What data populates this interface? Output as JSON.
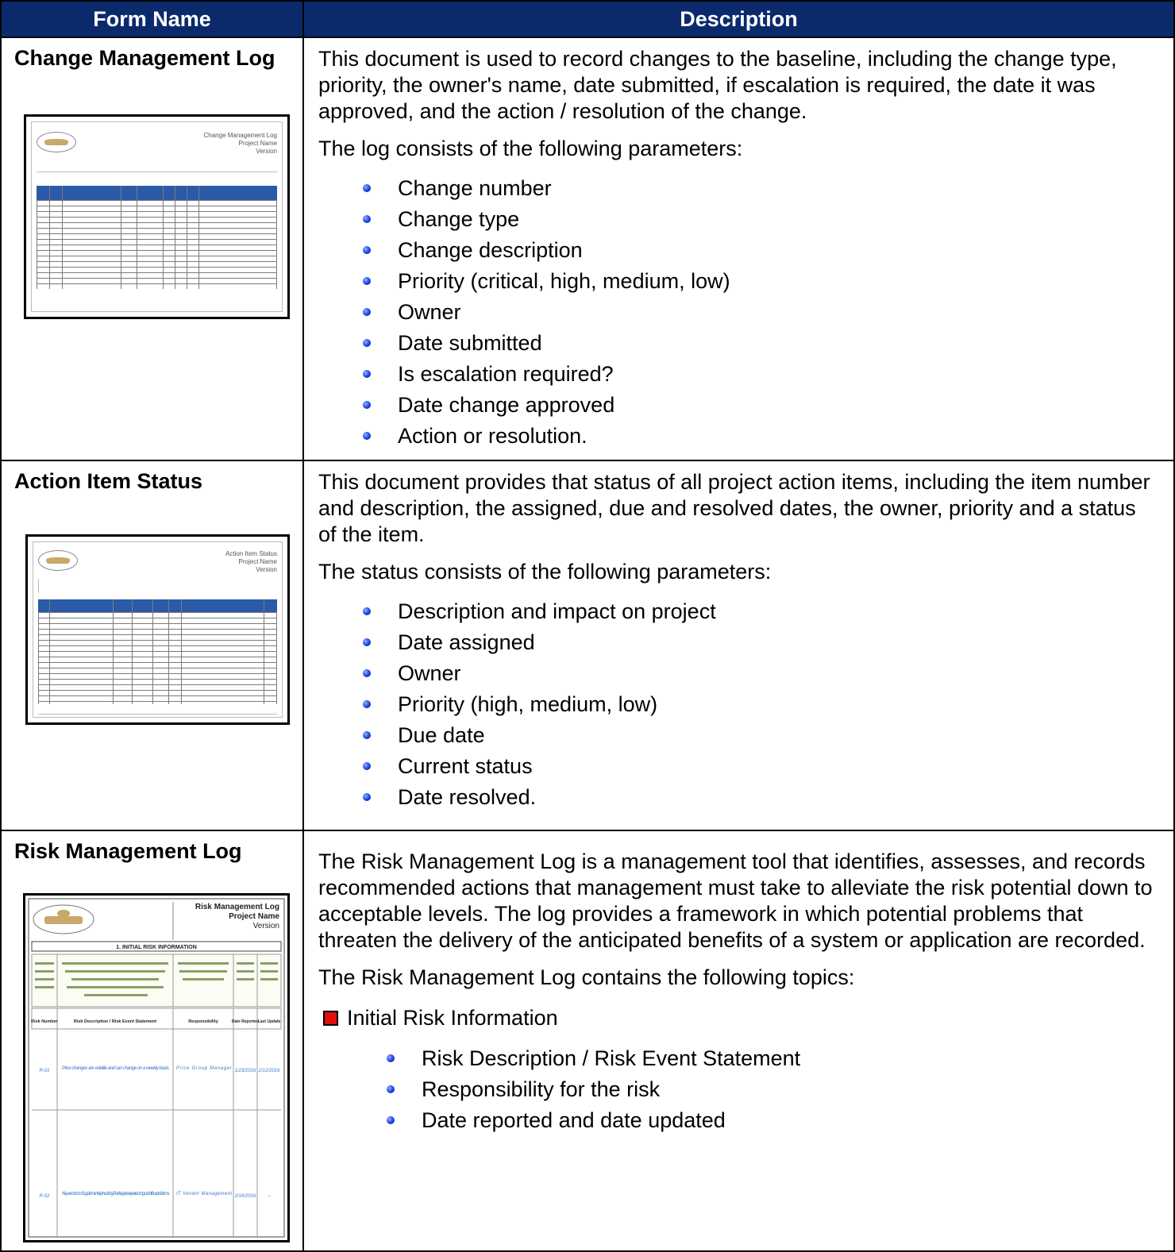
{
  "table": {
    "headers": {
      "form_name": "Form Name",
      "description": "Description"
    }
  },
  "rows": [
    {
      "name": "Change Management Log",
      "intro": "This document is used to record changes to the baseline, including the change type, priority, the owner's name, date submitted, if escalation is required, the date it was approved, and the action / resolution of the change.",
      "lead": "The log consists of the following parameters:",
      "bullets": [
        "Change number",
        "Change type",
        "Change description",
        "Priority (critical, high, medium, low)",
        "Owner",
        "Date submitted",
        "Is escalation required?",
        "Date change approved",
        "Action or resolution."
      ],
      "thumb_title": [
        "Change Management Log",
        "Project Name",
        "Version"
      ]
    },
    {
      "name": "Action Item Status",
      "intro": "This document provides that status of all project action items, including the item number and description, the assigned, due and resolved dates, the owner, priority and a status of the item.",
      "lead": "The status consists of the following parameters:",
      "bullets": [
        "Description and impact on project",
        "Date assigned",
        "Owner",
        "Priority (high, medium, low)",
        "Due date",
        "Current status",
        "Date resolved."
      ],
      "thumb_title": [
        "Action Item Status",
        "Project Name",
        "Version"
      ]
    },
    {
      "name": "Risk Management Log",
      "intro": "The Risk Management Log is a management tool that identifies, assesses, and records recommended actions that management must take to alleviate the risk potential down to acceptable levels. The log provides a framework in which potential problems that threaten the delivery of the anticipated benefits of a system or application are recorded.",
      "lead": "The Risk Management Log contains the following topics:",
      "topic": "Initial Risk Information",
      "bullets": [
        "Risk Description / Risk Event Statement",
        "Responsibility for the risk",
        "Date reported and date updated"
      ],
      "thumb_title": [
        "Risk Management Log",
        "Project Name",
        "Version"
      ],
      "thumb_section": "1. INITIAL RISK INFORMATION",
      "thumb_cols": [
        "Risk Number",
        "Risk Description / Risk Event Statement",
        "Responsibility",
        "Date Reported",
        "Last Update"
      ],
      "thumb_rows": [
        [
          "R-01",
          "Price changes are volatile and can change on a weekly basis.",
          "Price Group Manager",
          "1/23/2016",
          "2/12/2016"
        ],
        [
          "R-02",
          "Key vendor on Supplementary Invoicing Package is experiencing cash flow problems.",
          "IT Vendor Management",
          "2/16/2016",
          "--"
        ]
      ]
    }
  ],
  "colors": {
    "header_bg": "#0b2a6b",
    "bullet": "#1d3fe0",
    "square": "#e01010"
  }
}
